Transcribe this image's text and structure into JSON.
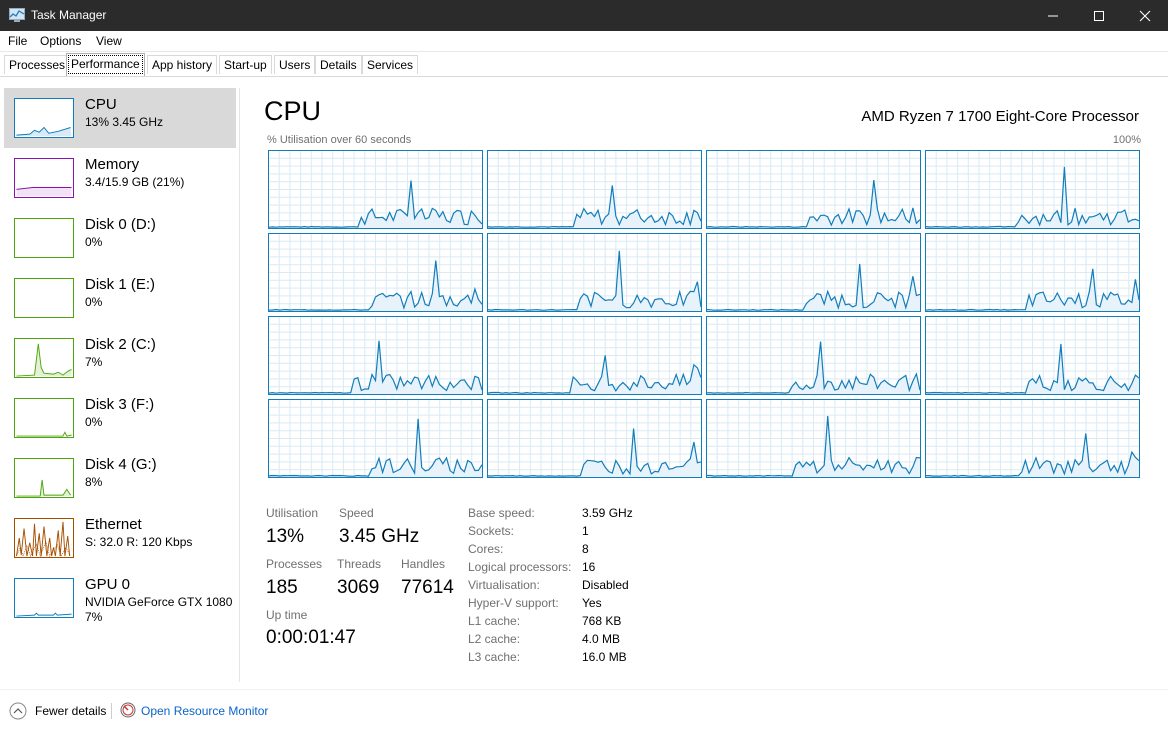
{
  "window": {
    "title": "Task Manager"
  },
  "menu": [
    "File",
    "Options",
    "View"
  ],
  "tabs": [
    "Processes",
    "Performance",
    "App history",
    "Start-up",
    "Users",
    "Details",
    "Services"
  ],
  "active_tab": "Performance",
  "sidebar": [
    {
      "title": "CPU",
      "sub": "13% 3.45 GHz",
      "color": "#117dbb"
    },
    {
      "title": "Memory",
      "sub": "3.4/15.9 GB (21%)",
      "color": "#8b12ae"
    },
    {
      "title": "Disk 0 (D:)",
      "sub": "0%",
      "color": "#4da60c"
    },
    {
      "title": "Disk 1 (E:)",
      "sub": "0%",
      "color": "#4da60c"
    },
    {
      "title": "Disk 2 (C:)",
      "sub": "7%",
      "color": "#4da60c"
    },
    {
      "title": "Disk 3 (F:)",
      "sub": "0%",
      "color": "#4da60c"
    },
    {
      "title": "Disk 4 (G:)",
      "sub": "8%",
      "color": "#4da60c"
    },
    {
      "title": "Ethernet",
      "sub": "S: 32.0  R: 120 Kbps",
      "color": "#a74f01"
    },
    {
      "title": "GPU 0",
      "sub": "NVIDIA GeForce GTX 1080",
      "sub2": "7%",
      "color": "#117dbb"
    }
  ],
  "main": {
    "title": "CPU",
    "processor": "AMD Ryzen 7 1700 Eight-Core Processor",
    "graph_label": "% Utilisation over 60 seconds",
    "graph_max": "100%"
  },
  "stats": {
    "utilisation_label": "Utilisation",
    "utilisation": "13%",
    "speed_label": "Speed",
    "speed": "3.45 GHz",
    "processes_label": "Processes",
    "processes": "185",
    "threads_label": "Threads",
    "threads": "3069",
    "handles_label": "Handles",
    "handles": "77614",
    "uptime_label": "Up time",
    "uptime": "0:00:01:47"
  },
  "specs": [
    {
      "label": "Base speed:",
      "value": "3.59 GHz"
    },
    {
      "label": "Sockets:",
      "value": "1"
    },
    {
      "label": "Cores:",
      "value": "8"
    },
    {
      "label": "Logical processors:",
      "value": "16"
    },
    {
      "label": "Virtualisation:",
      "value": "Disabled"
    },
    {
      "label": "Hyper-V support:",
      "value": "Yes"
    },
    {
      "label": "L1 cache:",
      "value": "768 KB"
    },
    {
      "label": "L2 cache:",
      "value": "4.0 MB"
    },
    {
      "label": "L3 cache:",
      "value": "16.0 MB"
    }
  ],
  "footer": {
    "fewer_details": "Fewer details",
    "open_resource_monitor": "Open Resource Monitor"
  }
}
